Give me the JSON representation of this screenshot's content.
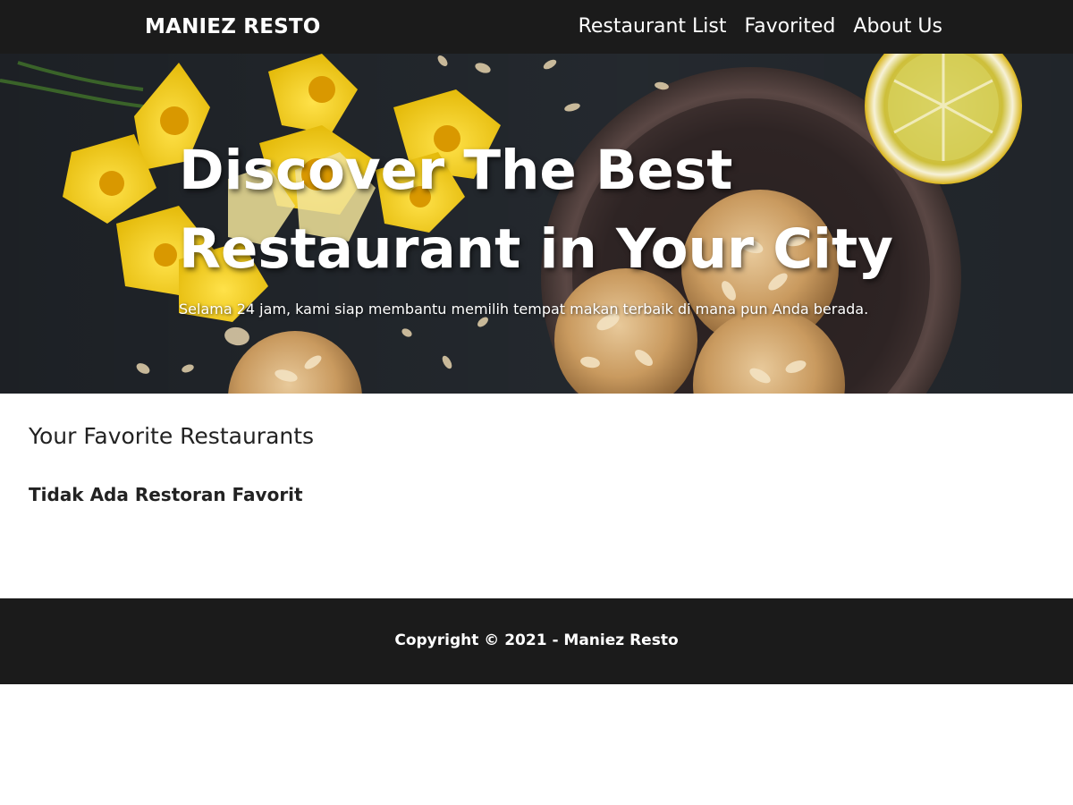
{
  "header": {
    "brand": "MANIEZ RESTO",
    "nav": [
      {
        "label": "Restaurant List"
      },
      {
        "label": "Favorited"
      },
      {
        "label": "About Us"
      }
    ]
  },
  "hero": {
    "title": "Discover The Best Restaurant in Your City",
    "subtitle": "Selama 24 jam, kami siap membantu memilih tempat makan terbaik di mana pun Anda berada."
  },
  "main": {
    "heading": "Your Favorite Restaurants",
    "empty_message": "Tidak Ada Restoran Favorit"
  },
  "footer": {
    "text": "Copyright © 2021 - Maniez Resto"
  },
  "colors": {
    "nav_background": "#1b1b1b",
    "footer_background": "#1b1b1b",
    "text_dark": "#222222",
    "text_light": "#ffffff"
  }
}
